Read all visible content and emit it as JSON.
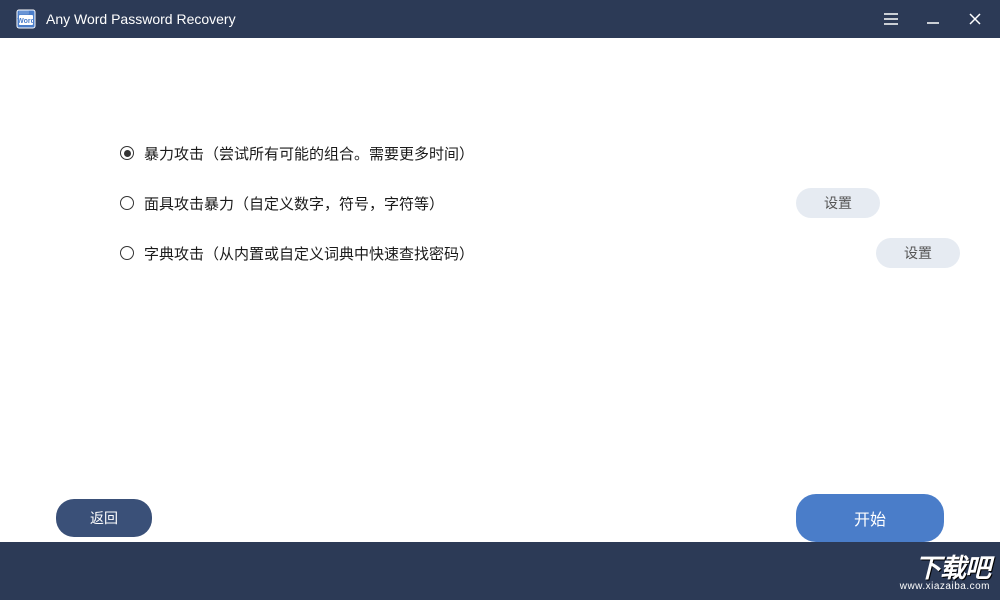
{
  "titlebar": {
    "app_title": "Any Word Password Recovery"
  },
  "options": [
    {
      "label": "暴力攻击（尝试所有可能的组合。需要更多时间）",
      "selected": true,
      "has_settings": false
    },
    {
      "label": "面具攻击暴力（自定义数字，符号，字符等）",
      "selected": false,
      "has_settings": true,
      "settings_label": "设置"
    },
    {
      "label": "字典攻击（从内置或自定义词典中快速查找密码）",
      "selected": false,
      "has_settings": true,
      "settings_label": "设置"
    }
  ],
  "buttons": {
    "back": "返回",
    "start": "开始"
  },
  "watermark": {
    "main": "下载吧",
    "sub": "www.xiazaiba.com"
  }
}
